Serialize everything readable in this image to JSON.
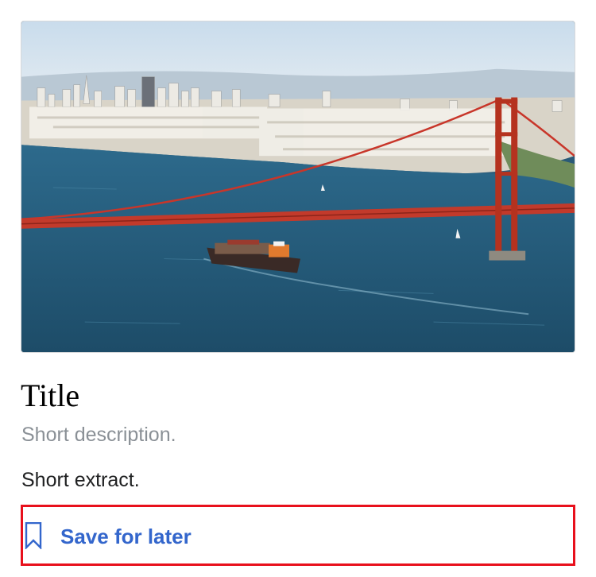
{
  "card": {
    "image_alt": "Golden Gate Bridge with San Francisco skyline and a container ship",
    "title": "Title",
    "description": "Short description.",
    "extract": "Short extract.",
    "save_action": {
      "label": "Save for later",
      "icon": "bookmark-icon"
    }
  },
  "colors": {
    "link": "#3366cc",
    "description": "#8a9096",
    "extract": "#202122",
    "highlight_border": "#e8101c"
  }
}
